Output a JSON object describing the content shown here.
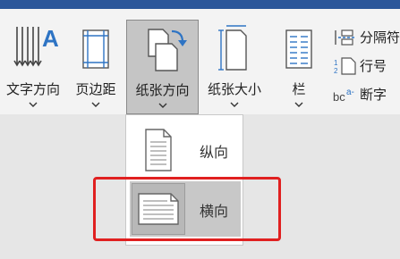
{
  "ribbon": {
    "text_direction_label": "文字方向",
    "margins_label": "页边距",
    "orientation_label": "纸张方向",
    "size_label": "纸张大小",
    "columns_label": "栏",
    "breaks_label": "分隔符",
    "line_numbers_label": "行号",
    "hyphenation_label": "断字"
  },
  "orientation_menu": {
    "options": [
      {
        "label": "纵向",
        "icon": "portrait-page-icon",
        "selected": false
      },
      {
        "label": "横向",
        "icon": "landscape-page-icon",
        "selected": true
      }
    ]
  },
  "colors": {
    "titlebar": "#2b579a",
    "ribbon_bg": "#f3f3f3",
    "highlight": "#e02020",
    "selected_bg": "#c8c8c8"
  }
}
